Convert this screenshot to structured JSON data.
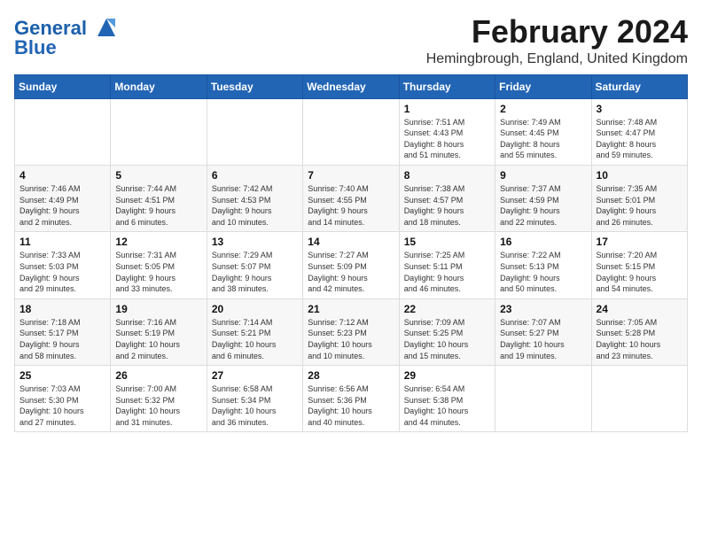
{
  "header": {
    "logo_line1": "General",
    "logo_line2": "Blue",
    "month_year": "February 2024",
    "location": "Hemingbrough, England, United Kingdom"
  },
  "weekdays": [
    "Sunday",
    "Monday",
    "Tuesday",
    "Wednesday",
    "Thursday",
    "Friday",
    "Saturday"
  ],
  "weeks": [
    [
      {
        "day": "",
        "info": ""
      },
      {
        "day": "",
        "info": ""
      },
      {
        "day": "",
        "info": ""
      },
      {
        "day": "",
        "info": ""
      },
      {
        "day": "1",
        "info": "Sunrise: 7:51 AM\nSunset: 4:43 PM\nDaylight: 8 hours\nand 51 minutes."
      },
      {
        "day": "2",
        "info": "Sunrise: 7:49 AM\nSunset: 4:45 PM\nDaylight: 8 hours\nand 55 minutes."
      },
      {
        "day": "3",
        "info": "Sunrise: 7:48 AM\nSunset: 4:47 PM\nDaylight: 8 hours\nand 59 minutes."
      }
    ],
    [
      {
        "day": "4",
        "info": "Sunrise: 7:46 AM\nSunset: 4:49 PM\nDaylight: 9 hours\nand 2 minutes."
      },
      {
        "day": "5",
        "info": "Sunrise: 7:44 AM\nSunset: 4:51 PM\nDaylight: 9 hours\nand 6 minutes."
      },
      {
        "day": "6",
        "info": "Sunrise: 7:42 AM\nSunset: 4:53 PM\nDaylight: 9 hours\nand 10 minutes."
      },
      {
        "day": "7",
        "info": "Sunrise: 7:40 AM\nSunset: 4:55 PM\nDaylight: 9 hours\nand 14 minutes."
      },
      {
        "day": "8",
        "info": "Sunrise: 7:38 AM\nSunset: 4:57 PM\nDaylight: 9 hours\nand 18 minutes."
      },
      {
        "day": "9",
        "info": "Sunrise: 7:37 AM\nSunset: 4:59 PM\nDaylight: 9 hours\nand 22 minutes."
      },
      {
        "day": "10",
        "info": "Sunrise: 7:35 AM\nSunset: 5:01 PM\nDaylight: 9 hours\nand 26 minutes."
      }
    ],
    [
      {
        "day": "11",
        "info": "Sunrise: 7:33 AM\nSunset: 5:03 PM\nDaylight: 9 hours\nand 29 minutes."
      },
      {
        "day": "12",
        "info": "Sunrise: 7:31 AM\nSunset: 5:05 PM\nDaylight: 9 hours\nand 33 minutes."
      },
      {
        "day": "13",
        "info": "Sunrise: 7:29 AM\nSunset: 5:07 PM\nDaylight: 9 hours\nand 38 minutes."
      },
      {
        "day": "14",
        "info": "Sunrise: 7:27 AM\nSunset: 5:09 PM\nDaylight: 9 hours\nand 42 minutes."
      },
      {
        "day": "15",
        "info": "Sunrise: 7:25 AM\nSunset: 5:11 PM\nDaylight: 9 hours\nand 46 minutes."
      },
      {
        "day": "16",
        "info": "Sunrise: 7:22 AM\nSunset: 5:13 PM\nDaylight: 9 hours\nand 50 minutes."
      },
      {
        "day": "17",
        "info": "Sunrise: 7:20 AM\nSunset: 5:15 PM\nDaylight: 9 hours\nand 54 minutes."
      }
    ],
    [
      {
        "day": "18",
        "info": "Sunrise: 7:18 AM\nSunset: 5:17 PM\nDaylight: 9 hours\nand 58 minutes."
      },
      {
        "day": "19",
        "info": "Sunrise: 7:16 AM\nSunset: 5:19 PM\nDaylight: 10 hours\nand 2 minutes."
      },
      {
        "day": "20",
        "info": "Sunrise: 7:14 AM\nSunset: 5:21 PM\nDaylight: 10 hours\nand 6 minutes."
      },
      {
        "day": "21",
        "info": "Sunrise: 7:12 AM\nSunset: 5:23 PM\nDaylight: 10 hours\nand 10 minutes."
      },
      {
        "day": "22",
        "info": "Sunrise: 7:09 AM\nSunset: 5:25 PM\nDaylight: 10 hours\nand 15 minutes."
      },
      {
        "day": "23",
        "info": "Sunrise: 7:07 AM\nSunset: 5:27 PM\nDaylight: 10 hours\nand 19 minutes."
      },
      {
        "day": "24",
        "info": "Sunrise: 7:05 AM\nSunset: 5:28 PM\nDaylight: 10 hours\nand 23 minutes."
      }
    ],
    [
      {
        "day": "25",
        "info": "Sunrise: 7:03 AM\nSunset: 5:30 PM\nDaylight: 10 hours\nand 27 minutes."
      },
      {
        "day": "26",
        "info": "Sunrise: 7:00 AM\nSunset: 5:32 PM\nDaylight: 10 hours\nand 31 minutes."
      },
      {
        "day": "27",
        "info": "Sunrise: 6:58 AM\nSunset: 5:34 PM\nDaylight: 10 hours\nand 36 minutes."
      },
      {
        "day": "28",
        "info": "Sunrise: 6:56 AM\nSunset: 5:36 PM\nDaylight: 10 hours\nand 40 minutes."
      },
      {
        "day": "29",
        "info": "Sunrise: 6:54 AM\nSunset: 5:38 PM\nDaylight: 10 hours\nand 44 minutes."
      },
      {
        "day": "",
        "info": ""
      },
      {
        "day": "",
        "info": ""
      }
    ]
  ]
}
